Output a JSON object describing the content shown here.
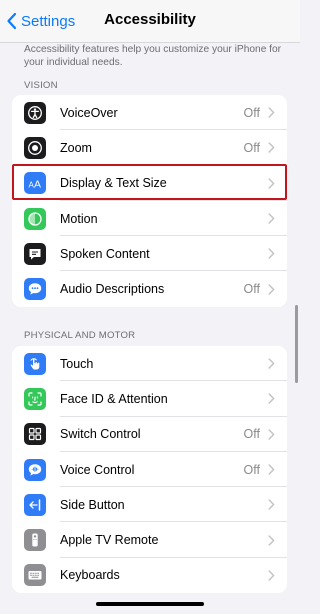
{
  "nav": {
    "back_label": "Settings",
    "title": "Accessibility"
  },
  "description": "Accessibility features help you customize your iPhone for your individual needs.",
  "sections": [
    {
      "header": "VISION",
      "rows": [
        {
          "label": "VoiceOver",
          "value": "Off",
          "icon": "voiceover-icon",
          "color": "#1c1c1e"
        },
        {
          "label": "Zoom",
          "value": "Off",
          "icon": "zoom-icon",
          "color": "#1c1c1e"
        },
        {
          "label": "Display & Text Size",
          "value": "",
          "icon": "text-size-icon",
          "color": "#2f7cf6"
        },
        {
          "label": "Motion",
          "value": "",
          "icon": "motion-icon",
          "color": "#34c759"
        },
        {
          "label": "Spoken Content",
          "value": "",
          "icon": "spoken-content-icon",
          "color": "#1c1c1e"
        },
        {
          "label": "Audio Descriptions",
          "value": "Off",
          "icon": "audio-descriptions-icon",
          "color": "#2f7cf6"
        }
      ]
    },
    {
      "header": "PHYSICAL AND MOTOR",
      "rows": [
        {
          "label": "Touch",
          "value": "",
          "icon": "touch-icon",
          "color": "#2f7cf6"
        },
        {
          "label": "Face ID & Attention",
          "value": "",
          "icon": "face-id-icon",
          "color": "#34c759"
        },
        {
          "label": "Switch Control",
          "value": "Off",
          "icon": "switch-control-icon",
          "color": "#1c1c1e"
        },
        {
          "label": "Voice Control",
          "value": "Off",
          "icon": "voice-control-icon",
          "color": "#2f7cf6"
        },
        {
          "label": "Side Button",
          "value": "",
          "icon": "side-button-icon",
          "color": "#2f7cf6"
        },
        {
          "label": "Apple TV Remote",
          "value": "",
          "icon": "tv-remote-icon",
          "color": "#8e8e93"
        },
        {
          "label": "Keyboards",
          "value": "",
          "icon": "keyboard-icon",
          "color": "#8e8e93"
        }
      ]
    }
  ],
  "colors": {
    "accent": "#0a7aff",
    "highlight": "#c4151c"
  }
}
